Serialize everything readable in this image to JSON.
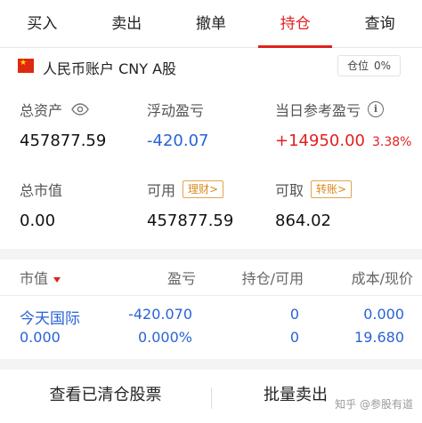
{
  "tabs": [
    {
      "label": "买入",
      "active": false
    },
    {
      "label": "卖出",
      "active": false
    },
    {
      "label": "撤单",
      "active": false
    },
    {
      "label": "持仓",
      "active": true
    },
    {
      "label": "查询",
      "active": false
    }
  ],
  "accent_color": "#e0211f",
  "account": {
    "label": "人民币账户 CNY A股",
    "flag_icon": "china-flag-icon",
    "position_label": "仓位",
    "position_value": "0%"
  },
  "summary": {
    "total_assets": {
      "label": "总资产",
      "value": "457877.59",
      "icon": "eye-icon"
    },
    "floating_pnl": {
      "label": "浮动盈亏",
      "value": "-420.07"
    },
    "today_pnl": {
      "label": "当日参考盈亏",
      "value": "+14950.00",
      "percent": "3.38%",
      "icon": "info-icon"
    },
    "market_value": {
      "label": "总市值",
      "value": "0.00"
    },
    "available": {
      "label": "可用",
      "value": "457877.59",
      "link": "理财>"
    },
    "withdrawable": {
      "label": "可取",
      "value": "864.02",
      "link": "转账>"
    }
  },
  "holdings": {
    "headers": {
      "market_value": "市值",
      "pnl": "盈亏",
      "position": "持仓/可用",
      "cost": "成本/现价"
    },
    "rows": [
      {
        "name": "今天国际",
        "market_value": "0.000",
        "pnl": "-420.070",
        "pnl_pct": "0.000%",
        "position": "0",
        "available": "0",
        "cost": "0.000",
        "price": "19.680"
      }
    ]
  },
  "footer": {
    "cleared_stocks": "查看已清仓股票",
    "batch_sell": "批量卖出"
  },
  "watermark": "知乎 @参股有道"
}
